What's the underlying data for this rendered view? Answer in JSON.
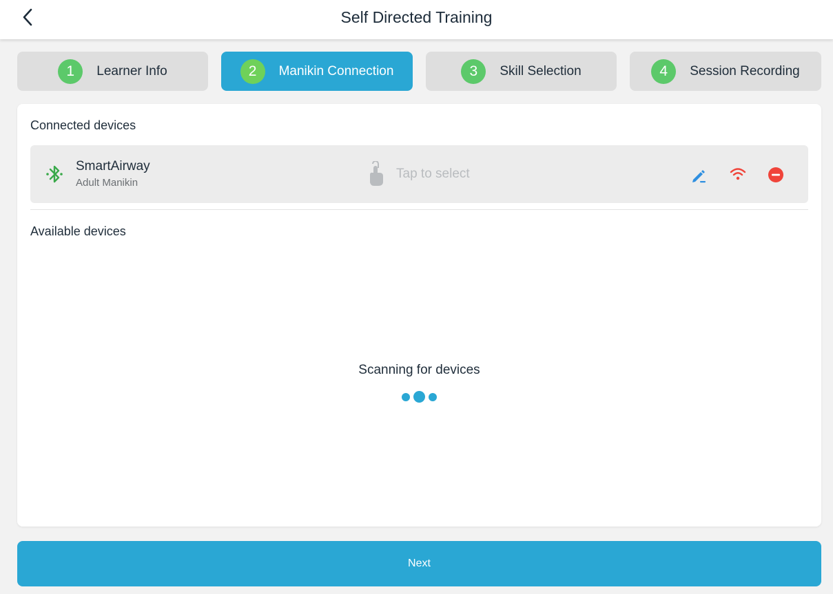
{
  "header": {
    "title": "Self Directed Training"
  },
  "steps": [
    {
      "number": "1",
      "label": "Learner Info",
      "active": false
    },
    {
      "number": "2",
      "label": "Manikin Connection",
      "active": true
    },
    {
      "number": "3",
      "label": "Skill Selection",
      "active": false
    },
    {
      "number": "4",
      "label": "Session Recording",
      "active": false
    }
  ],
  "connected": {
    "title": "Connected devices",
    "devices": [
      {
        "name": "SmartAirway",
        "subtitle": "Adult Manikin",
        "tap_hint": "Tap to select",
        "icons": {
          "connection": "bluetooth-icon",
          "tap": "tap-hand-icon",
          "edit": "pencil-icon",
          "signal": "wifi-icon",
          "remove": "remove-circle-icon"
        }
      }
    ]
  },
  "available": {
    "title": "Available devices",
    "scanning_text": "Scanning for devices"
  },
  "footer": {
    "next_label": "Next"
  },
  "colors": {
    "accent": "#2aa7d4",
    "step_badge": "#5cc96a",
    "bluetooth": "#3aa94a",
    "edit": "#2f8fe0",
    "wifi": "#f0443a",
    "remove": "#f0443a"
  }
}
